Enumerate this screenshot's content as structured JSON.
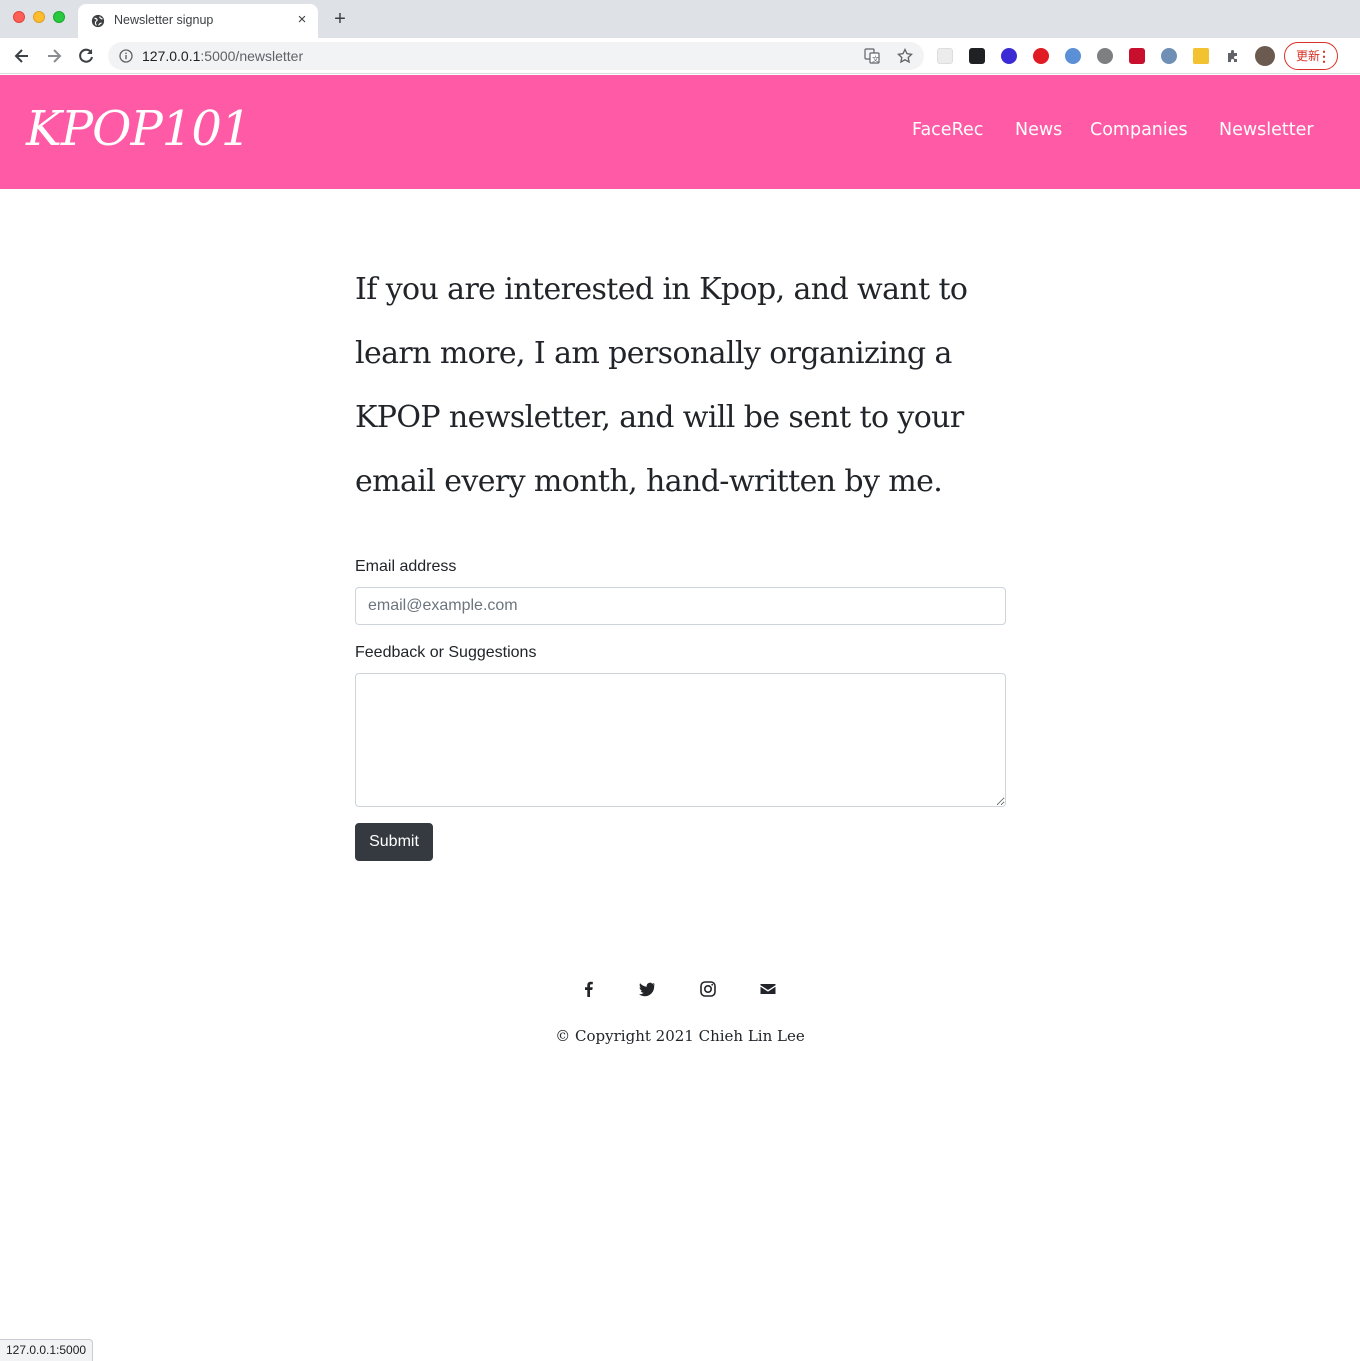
{
  "browser": {
    "tab_title": "Newsletter signup",
    "tab_close": "×",
    "new_tab": "+",
    "url_host": "127.0.0.1",
    "url_rest": ":5000/newsletter",
    "profile_button": "更新",
    "status_url": "127.0.0.1:5000"
  },
  "header": {
    "logo": "KPOP101",
    "nav": [
      "FaceRec",
      "News",
      "Companies",
      "Newsletter"
    ],
    "bg_color": "#ff5aa5"
  },
  "main": {
    "intro": "If you are interested in Kpop, and want to learn more, I am personally organizing a KPOP newsletter, and will be sent to your email every month, hand-written by me.",
    "email_label": "Email address",
    "email_placeholder": "email@example.com",
    "email_value": "",
    "feedback_label": "Feedback or Suggestions",
    "feedback_value": "",
    "submit_label": "Submit"
  },
  "footer": {
    "social_icons": [
      "facebook-icon",
      "twitter-icon",
      "instagram-icon",
      "envelope-icon"
    ],
    "copyright": "© Copyright 2021 Chieh Lin Lee"
  }
}
